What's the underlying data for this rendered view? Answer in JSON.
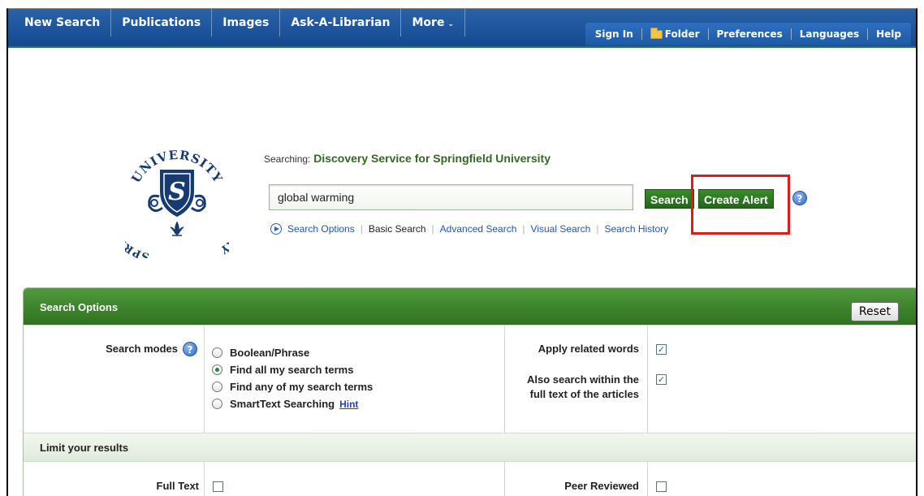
{
  "nav": {
    "items": [
      "New Search",
      "Publications",
      "Images",
      "Ask-A-Librarian",
      "More"
    ],
    "more_caret": "⌄",
    "right_items": [
      "Sign In",
      "Folder",
      "Preferences",
      "Languages",
      "Help"
    ]
  },
  "logo": {
    "text_top": "UNIVERSITY",
    "text_left": "SPRINGFIELD",
    "text_right": "LIBRARY",
    "shield_letter": "S"
  },
  "search": {
    "searching_label": "Searching:",
    "database": "Discovery Service for Springfield University",
    "query": "global warming",
    "search_button": "Search",
    "create_alert_button": "Create Alert",
    "help_glyph": "?",
    "links": {
      "search_options": "Search Options",
      "basic_search": "Basic Search",
      "advanced_search": "Advanced Search",
      "visual_search": "Visual Search",
      "search_history": "Search History"
    }
  },
  "options": {
    "title": "Search Options",
    "reset": "Reset",
    "search_modes_label": "Search modes",
    "modes": [
      {
        "label": "Boolean/Phrase",
        "selected": false
      },
      {
        "label": "Find all my search terms",
        "selected": true
      },
      {
        "label": "Find any of my search terms",
        "selected": false
      },
      {
        "label": "SmartText Searching",
        "selected": false
      }
    ],
    "hint": "Hint",
    "apply_related_words": "Apply related words",
    "apply_related_checked": true,
    "also_search_line1": "Also search within the",
    "also_search_line2": "full text of the articles",
    "also_search_checked": true,
    "limit_title": "Limit your results",
    "full_text": "Full Text",
    "peer_reviewed": "Peer Reviewed",
    "check_glyph": "✓"
  },
  "colors": {
    "nav_blue": "#14498f",
    "accent_green": "#2f7220",
    "highlight_red": "#e01b1b"
  }
}
